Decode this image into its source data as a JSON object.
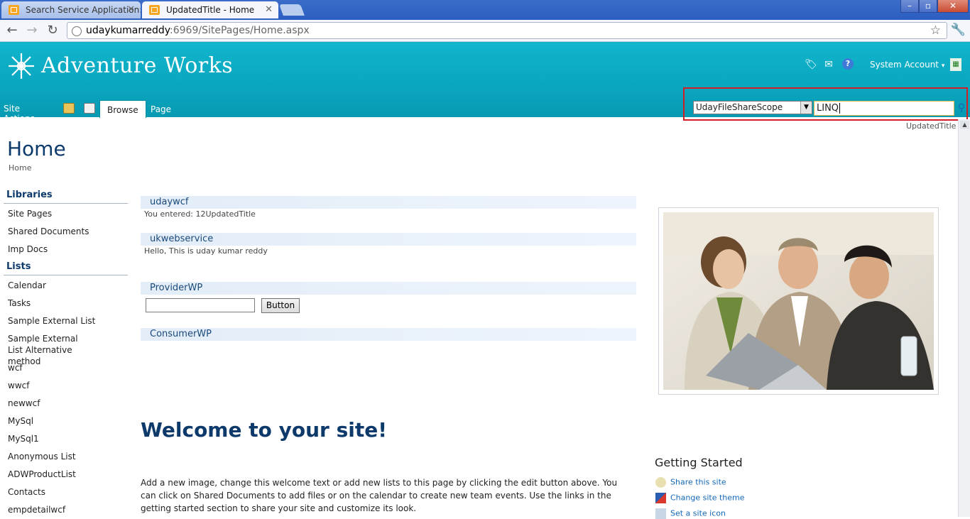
{
  "browser": {
    "tabs": [
      {
        "label": "Search Service Application: Vi",
        "active": false
      },
      {
        "label": "UpdatedTitle - Home",
        "active": true
      }
    ],
    "url_host": "udaykumarreddy",
    "url_rest": ":6969/SitePages/Home.aspx",
    "window_controls": {
      "minimize": "–",
      "maximize": "▫",
      "close": "✕"
    }
  },
  "header": {
    "brand": "Adventure Works",
    "user": "System Account",
    "user_caret": "▾",
    "site_actions": "Site Actions",
    "site_actions_caret": "▾",
    "ribbon_tabs": [
      {
        "label": "Browse",
        "active": true
      },
      {
        "label": "Page",
        "active": false
      }
    ],
    "icons": [
      "tag-icon",
      "notes-icon",
      "help-icon",
      "export-excel-icon"
    ],
    "colors": {
      "header": "#0aa6bf",
      "title": "#0e3a6b",
      "link": "#1468b8",
      "highlight": "#d21f25"
    }
  },
  "search": {
    "scope": "UdayFileShareScope",
    "query": "LINQ"
  },
  "site_title_link": "UpdatedTitle",
  "page": {
    "title": "Home",
    "breadcrumb": "Home"
  },
  "quick_launch": {
    "libraries_heading": "Libraries",
    "libraries": [
      "Site Pages",
      "Shared Documents",
      "Imp Docs"
    ],
    "lists_heading": "Lists",
    "lists": [
      "Calendar",
      "Tasks",
      "Sample External List",
      "Sample External List Alternative method",
      "wcf",
      "wwcf",
      "newwcf",
      "MySql",
      "MySql1",
      "Anonymous List",
      "ADWProductList",
      "Contacts",
      "empdetailwcf"
    ]
  },
  "webparts": {
    "udaywcf": {
      "title": "udaywcf",
      "text": "You entered: 12UpdatedTitle"
    },
    "ukwebservice": {
      "title": "ukwebservice",
      "text": "Hello, This is uday kumar reddy"
    },
    "provider": {
      "title": "ProviderWP",
      "button": "Button",
      "input_value": ""
    },
    "consumer": {
      "title": "ConsumerWP"
    }
  },
  "welcome": {
    "title": "Welcome to your site!",
    "body": "Add a new image, change this welcome text or add new lists to this page by clicking the edit button above. You can click on Shared Documents to add files or on the calendar to create new team events. Use the links in the getting started section to share your site and customize its look."
  },
  "getting_started": {
    "heading": "Getting Started",
    "items": [
      "Share this site",
      "Change site theme",
      "Set a site icon"
    ]
  }
}
